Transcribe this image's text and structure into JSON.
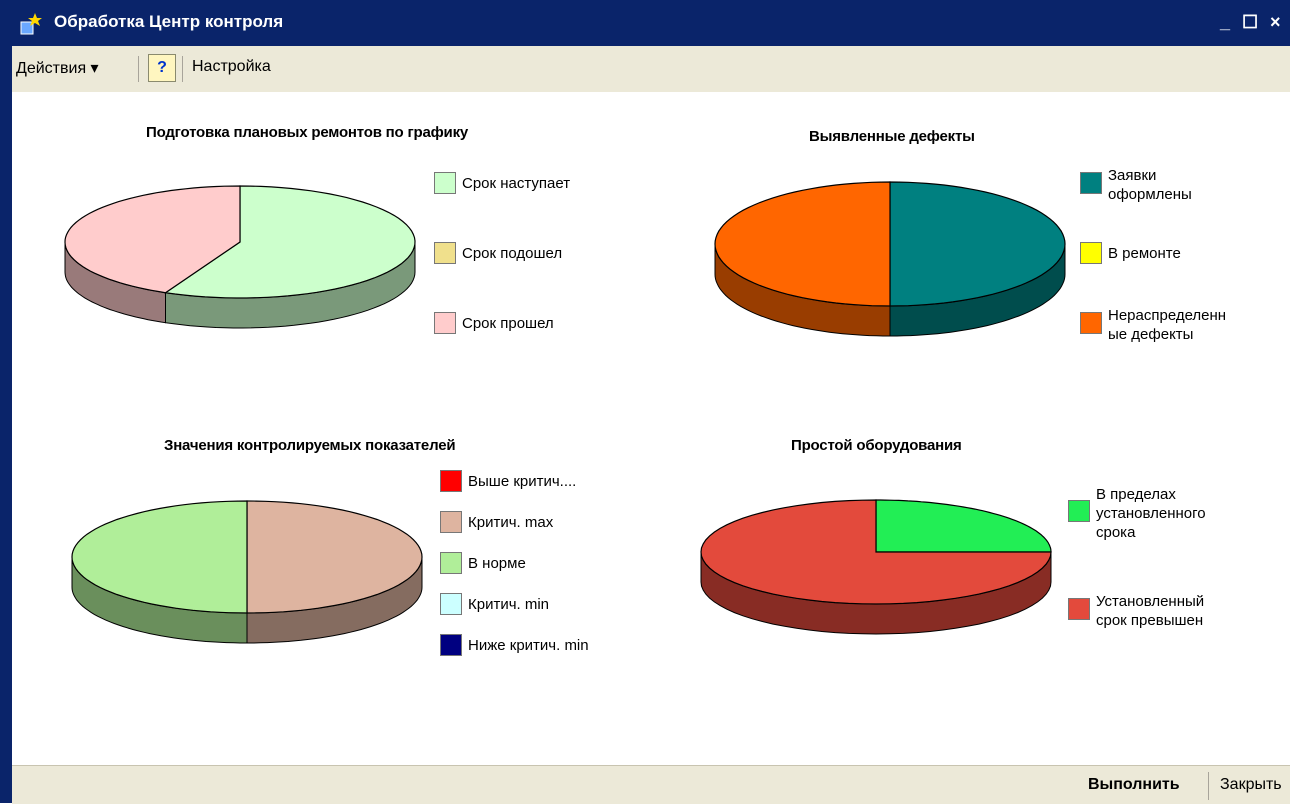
{
  "window": {
    "title": "Обработка  Центр контроля",
    "minimize_label": "_",
    "maximize_label": "☐",
    "close_label": "×"
  },
  "toolbar": {
    "actions_label": "Действия ▾",
    "help_label": "?",
    "settings_label": "Настройка"
  },
  "bottombar": {
    "execute_label": "Выполнить",
    "close_label": "Закрыть"
  },
  "chart_data": [
    {
      "type": "pie",
      "title": "Подготовка плановых ремонтов по графику",
      "categories": [
        "Срок наступает",
        "Срок подошел",
        "Срок прошел"
      ],
      "values": [
        57,
        0,
        43
      ],
      "colors": [
        "#ccffcc",
        "#f0e08c",
        "#ffcccc"
      ]
    },
    {
      "type": "pie",
      "title": "Выявленные дефекты",
      "categories": [
        "Заявки оформлены",
        "В ремонте",
        "Нераспределенные дефекты"
      ],
      "legend_lines": [
        [
          "Заявки",
          "оформлены"
        ],
        [
          "В ремонте"
        ],
        [
          "Нераспределенн",
          "ые дефекты"
        ]
      ],
      "values": [
        50,
        0,
        50
      ],
      "colors": [
        "#008080",
        "#ffff00",
        "#ff6600"
      ]
    },
    {
      "type": "pie",
      "title": "Значения контролируемых показателей",
      "categories": [
        "Выше критич....",
        "Критич. max",
        "В норме",
        "Критич. min",
        "Ниже критич. min"
      ],
      "values": [
        0,
        50,
        50,
        0,
        0
      ],
      "colors": [
        "#ff0000",
        "#deb4a0",
        "#b0ee99",
        "#ccffff",
        "#000080"
      ]
    },
    {
      "type": "pie",
      "title": "Простой оборудования",
      "categories": [
        "В пределах установленного срока",
        "Установленный срок превышен"
      ],
      "legend_lines": [
        [
          "В пределах",
          "установленного",
          "срока"
        ],
        [
          "Установленный",
          "срок превышен"
        ]
      ],
      "values": [
        25,
        75
      ],
      "colors": [
        "#22ee55",
        "#e34a3c"
      ]
    }
  ]
}
